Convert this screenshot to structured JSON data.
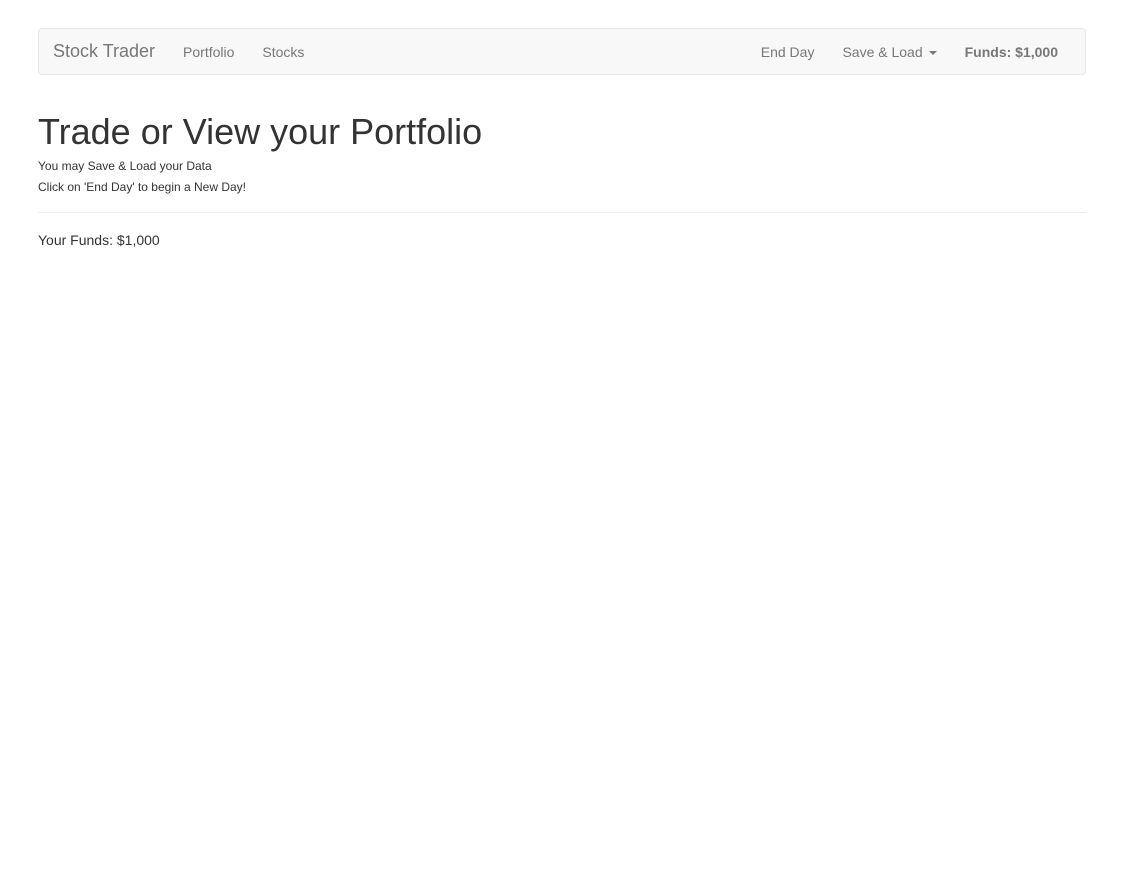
{
  "navbar": {
    "brand": "Stock Trader",
    "links": {
      "portfolio": "Portfolio",
      "stocks": "Stocks"
    },
    "end_day": "End Day",
    "save_load": "Save & Load",
    "funds": "Funds: $1,000"
  },
  "main": {
    "title": "Trade or View your Portfolio",
    "subtitle_1": "You may Save & Load your Data",
    "subtitle_2": "Click on 'End Day' to begin a New Day!",
    "funds": "Your Funds: $1,000"
  },
  "icons": {
    "dropdown": "caret-down-icon"
  },
  "colors": {
    "navbar_bg": "#f8f8f8",
    "navbar_border": "#e7e7e7",
    "nav_text": "#777777",
    "body_text": "#333333"
  }
}
